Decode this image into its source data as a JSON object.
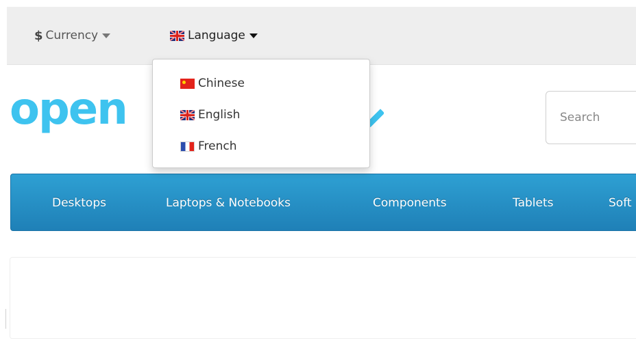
{
  "topbar": {
    "currency": {
      "symbol": "$",
      "label": "Currency",
      "caret_icon": "caret-down-icon"
    },
    "language": {
      "flag_icon": "uk-flag-icon",
      "label": "Language",
      "caret_icon": "caret-down-icon"
    }
  },
  "logo": {
    "visible_text": "open"
  },
  "search": {
    "placeholder": "Search"
  },
  "menu": {
    "items": [
      "Desktops",
      "Laptops & Notebooks",
      "Components",
      "Tablets",
      "Soft"
    ]
  },
  "language_dropdown": {
    "items": [
      {
        "label": "Chinese",
        "flag_icon": "china-flag-icon"
      },
      {
        "label": "English",
        "flag_icon": "uk-flag-icon"
      },
      {
        "label": "French",
        "flag_icon": "france-flag-icon"
      }
    ]
  },
  "colors": {
    "brand": "#3ec3ef",
    "menu_top": "#2ea0d3",
    "menu_bottom": "#1f80b7",
    "topbar_bg": "#eeeeee"
  }
}
